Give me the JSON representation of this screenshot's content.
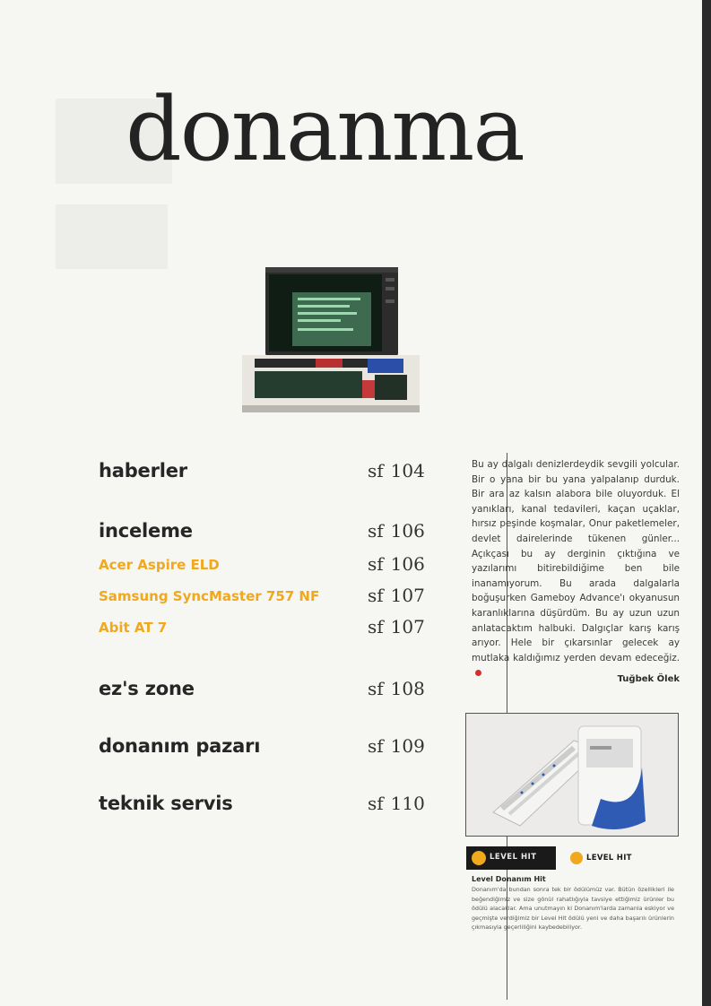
{
  "title": "donanma",
  "toc": [
    {
      "label": "haberler",
      "page": "104",
      "style": "section"
    },
    {
      "label": "inceleme",
      "page": "106",
      "style": "section"
    },
    {
      "label": "Acer Aspire ELD",
      "page": "106",
      "style": "sub"
    },
    {
      "label": "Samsung SyncMaster 757 NF",
      "page": "107",
      "style": "sub"
    },
    {
      "label": "Abit AT 7",
      "page": "107",
      "style": "sub"
    },
    {
      "label": "ez's zone",
      "page": "108",
      "style": "section"
    },
    {
      "label": "donanım pazarı",
      "page": "109",
      "style": "section"
    },
    {
      "label": "teknik servis",
      "page": "110",
      "style": "section"
    }
  ],
  "page_prefix": "sf",
  "editorial": {
    "text": "Bu ay dalgalı denizlerdeydik sevgili yolcular. Bir o yana bir bu yana yalpalanıp durduk. Bir ara az kalsın alabora bile oluyorduk. El yanıkları, kanal tedavileri, kaçan uçaklar, hırsız peşinde koşmalar, Onur paketlemeler, devlet dairelerinde tükenen günler... Açıkçası bu ay derginin çıktığına ve yazılarımı bitirebildiğime ben bile inanamıyorum. Bu arada dalgalarla boğuşurken Gameboy Advance'ı okyanusun karanlıklarına düşürdüm. Bu ay uzun uzun anlatacaktım halbuki. Dalgıçlar karış karış arıyor. Hele bir çıkarsınlar gelecek ay mutlaka kaldığımız yerden devam edeceğiz.",
    "author": "Tuğbek Ölek"
  },
  "level_hit": {
    "badge_dark": "LEVEL HIT",
    "badge_light": "LEVEL HIT",
    "caption_title": "Level Donanım Hit",
    "caption_body": "Donanım'da bundan sonra tek bir ödülümüz var. Bütün özellikleri ile beğendiğimiz ve size gönül rahatlığıyla tavsiye ettiğimiz ürünler bu ödülü alacaklar. Ama unutmayın ki Donanım'larda zamanla eskiyor ve geçmişte verdiğimiz bir Level Hit ödülü yeni ve daha başarılı ürünlerin çıkmasıyla geçerliliğini kaybedebiliyor."
  },
  "colors": {
    "accent": "#f0a81c",
    "text": "#1e1e1e",
    "background": "#f6f6f3"
  }
}
